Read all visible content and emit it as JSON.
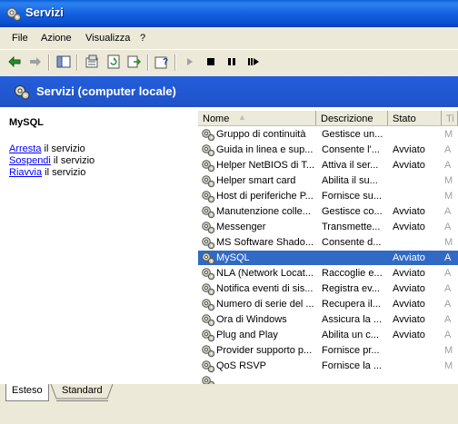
{
  "window": {
    "title": "Servizi",
    "icon": "services-gear-icon"
  },
  "menu": [
    "File",
    "Azione",
    "Visualizza",
    "?"
  ],
  "toolbar": [
    {
      "name": "back-arrow-icon"
    },
    {
      "name": "forward-arrow-icon"
    },
    {
      "name": "show-hide-tree-icon"
    },
    {
      "name": "properties-icon"
    },
    {
      "name": "refresh-icon"
    },
    {
      "name": "export-list-icon"
    },
    {
      "name": "help-icon"
    },
    {
      "name": "start-service-icon"
    },
    {
      "name": "stop-service-icon"
    },
    {
      "name": "pause-service-icon"
    },
    {
      "name": "restart-service-icon"
    }
  ],
  "band": {
    "title": "Servizi (computer locale)"
  },
  "details": {
    "service_name": "MySQL",
    "actions": [
      {
        "link": "Arresta",
        "rest": " il servizio"
      },
      {
        "link": "Sospendi",
        "rest": " il servizio"
      },
      {
        "link": "Riavvia",
        "rest": " il servizio"
      }
    ]
  },
  "list": {
    "columns": [
      "Nome",
      "Descrizione",
      "Stato",
      "Ti"
    ],
    "rows": [
      {
        "name": "Gruppo di continuità",
        "desc": "Gestisce un...",
        "state": "",
        "type": "M",
        "selected": false
      },
      {
        "name": "Guida in linea e sup...",
        "desc": "Consente l'...",
        "state": "Avviato",
        "type": "A",
        "selected": false
      },
      {
        "name": "Helper NetBIOS di T...",
        "desc": "Attiva il ser...",
        "state": "Avviato",
        "type": "A",
        "selected": false
      },
      {
        "name": "Helper smart card",
        "desc": "Abilita il su...",
        "state": "",
        "type": "M",
        "selected": false
      },
      {
        "name": "Host di periferiche P...",
        "desc": "Fornisce su...",
        "state": "",
        "type": "M",
        "selected": false
      },
      {
        "name": "Manutenzione colle...",
        "desc": "Gestisce co...",
        "state": "Avviato",
        "type": "A",
        "selected": false
      },
      {
        "name": "Messenger",
        "desc": "Transmette...",
        "state": "Avviato",
        "type": "A",
        "selected": false
      },
      {
        "name": "MS Software Shado...",
        "desc": "Consente d...",
        "state": "",
        "type": "M",
        "selected": false
      },
      {
        "name": "MySQL",
        "desc": "",
        "state": "Avviato",
        "type": "A",
        "selected": true
      },
      {
        "name": "NLA (Network Locat...",
        "desc": "Raccoglie e...",
        "state": "Avviato",
        "type": "A",
        "selected": false
      },
      {
        "name": "Notifica eventi di sis...",
        "desc": "Registra ev...",
        "state": "Avviato",
        "type": "A",
        "selected": false
      },
      {
        "name": "Numero di serie del ...",
        "desc": "Recupera il...",
        "state": "Avviato",
        "type": "A",
        "selected": false
      },
      {
        "name": "Ora di Windows",
        "desc": "Assicura la ...",
        "state": "Avviato",
        "type": "A",
        "selected": false
      },
      {
        "name": "Plug and Play",
        "desc": "Abilita un c...",
        "state": "Avviato",
        "type": "A",
        "selected": false
      },
      {
        "name": "Provider supporto p...",
        "desc": "Fornisce pr...",
        "state": "",
        "type": "M",
        "selected": false
      },
      {
        "name": "QoS RSVP",
        "desc": "Fornisce la ...",
        "state": "",
        "type": "M",
        "selected": false
      },
      {
        "name": "",
        "desc": "",
        "state": "",
        "type": "",
        "selected": false
      }
    ]
  },
  "tabs": [
    "Esteso",
    "Standard"
  ]
}
